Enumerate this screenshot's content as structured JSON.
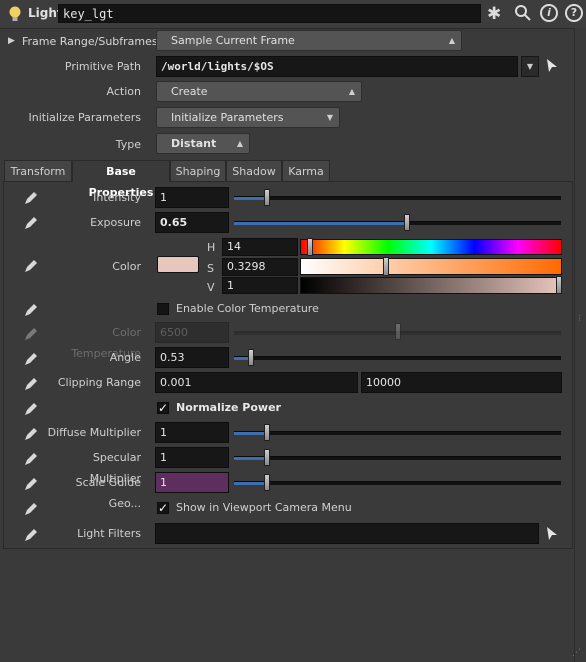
{
  "header": {
    "node_type": "Light",
    "node_name": "key_lgt"
  },
  "folder": {
    "label": "Frame Range/Subframes"
  },
  "params": {
    "sample_menu": "Sample Current Frame",
    "primitive_path_label": "Primitive Path",
    "primitive_path": "/world/lights/$OS",
    "action_label": "Action",
    "action_value": "Create",
    "init_label": "Initialize Parameters",
    "init_value": "Initialize Parameters",
    "type_label": "Type",
    "type_value": "Distant"
  },
  "tabs": [
    "Transform",
    "Base Properties",
    "Shaping",
    "Shadow",
    "Karma"
  ],
  "active_tab": "Base Properties",
  "base": {
    "intensity_label": "Intensity",
    "intensity": "1",
    "exposure_label": "Exposure",
    "exposure": "0.65",
    "color_label": "Color",
    "color_swatch": "#e7c6bd",
    "h_label": "H",
    "h": "14",
    "s_label": "S",
    "s": "0.3298",
    "v_label": "V",
    "v": "1",
    "enable_temp_label": "Enable Color Temperature",
    "color_temp_label": "Color Temperature",
    "color_temp": "6500",
    "angle_label": "Angle",
    "angle": "0.53",
    "clip_label": "Clipping Range",
    "clip_near": "0.001",
    "clip_far": "10000",
    "normalize_label": "Normalize Power",
    "diffuse_label": "Diffuse Multiplier",
    "diffuse": "1",
    "specular_label": "Specular Multiplier",
    "specular": "1",
    "scale_label": "Scale Guide Geo...",
    "scale": "1",
    "show_cam_label": "Show in Viewport Camera Menu",
    "filters_label": "Light Filters",
    "filters": ""
  },
  "slider_levels": {
    "intensity": 0.1,
    "exposure": 0.53,
    "hue": 0.039,
    "saturation": 0.33,
    "value": 1.0,
    "color_temp": 0.5,
    "angle": 0.053,
    "diffuse": 0.1,
    "specular": 0.1,
    "scale": 0.1
  },
  "colors": {
    "accent": "#3d6fb0",
    "scale_field": "#5e2f5e",
    "bulb": "#f0d060"
  }
}
